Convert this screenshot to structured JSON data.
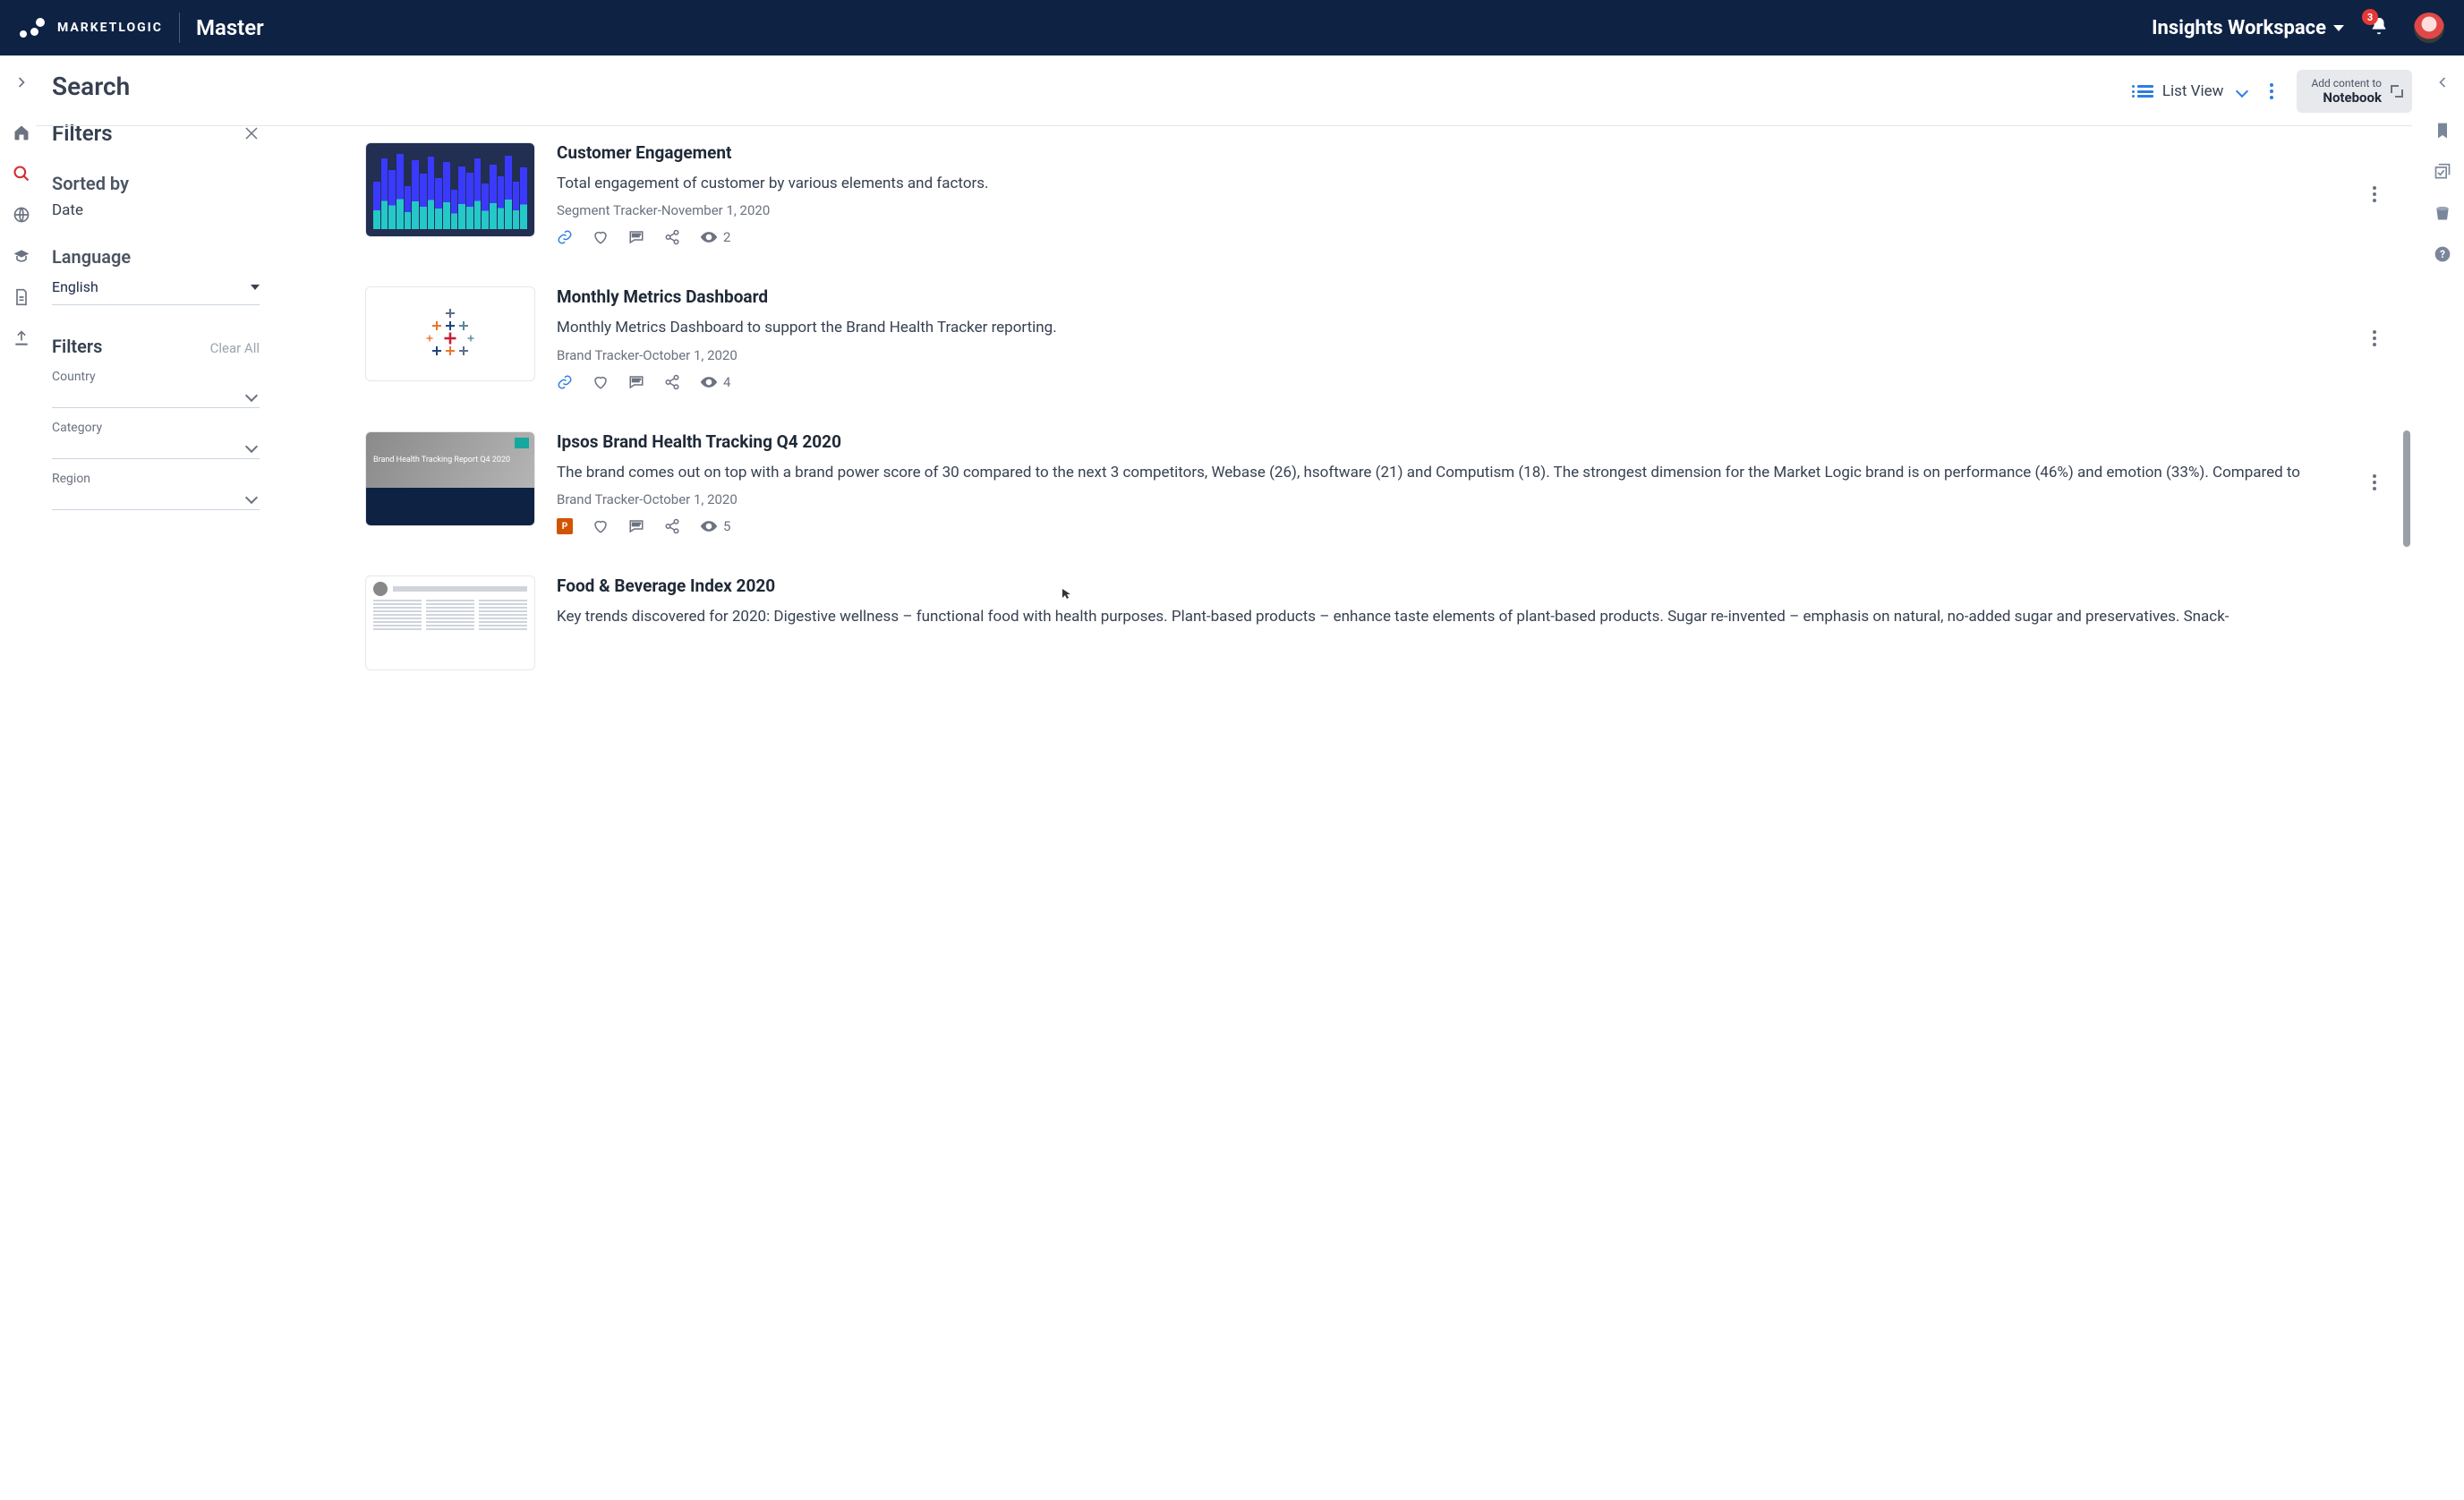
{
  "header": {
    "brand": "MARKETLOGIC",
    "context": "Master",
    "workspace": "Insights Workspace",
    "notif_count": "3"
  },
  "page": {
    "title": "Search",
    "view_label": "List View",
    "notebook_line1": "Add content to",
    "notebook_line2": "Notebook"
  },
  "filters": {
    "heading": "Filters",
    "sorted_by_label": "Sorted by",
    "sorted_by_value": "Date",
    "language_label": "Language",
    "language_value": "English",
    "filters_label": "Filters",
    "clear_all": "Clear All",
    "facets": {
      "country": "Country",
      "category": "Category",
      "region": "Region"
    }
  },
  "results": [
    {
      "title": "Customer Engagement",
      "desc": "Total engagement of customer by various elements and factors.",
      "source": "Segment Tracker-November 1, 2020",
      "views": "2",
      "thumb": "chart",
      "badge": "link"
    },
    {
      "title": "Monthly Metrics Dashboard",
      "desc": "Monthly Metrics Dashboard to support the Brand Health Tracker reporting.",
      "source": "Brand Tracker-October 1, 2020",
      "views": "4",
      "thumb": "tableau",
      "badge": "link"
    },
    {
      "title": "Ipsos Brand Health Tracking Q4 2020",
      "desc": "The brand comes out on top with a brand power score of 30 compared to the next 3 competitors, Webase (26), hsoftware (21) and Computism (18). The strongest dimension for the Market Logic brand is on performance (46%) and emotion (33%). Compared to",
      "source": "Brand Tracker-October 1, 2020",
      "views": "5",
      "thumb": "report",
      "badge": "ppt",
      "report_thumb_text": "Brand Health Tracking Report Q4 2020"
    },
    {
      "title": "Food & Beverage Index 2020",
      "desc": "Key trends discovered for 2020: Digestive wellness – functional food with health purposes. Plant-based products – enhance taste elements of plant-based products. Sugar re-invented – emphasis on natural, no-added sugar and preservatives. Snack-",
      "source": "",
      "views": "",
      "thumb": "doc",
      "badge": ""
    }
  ]
}
